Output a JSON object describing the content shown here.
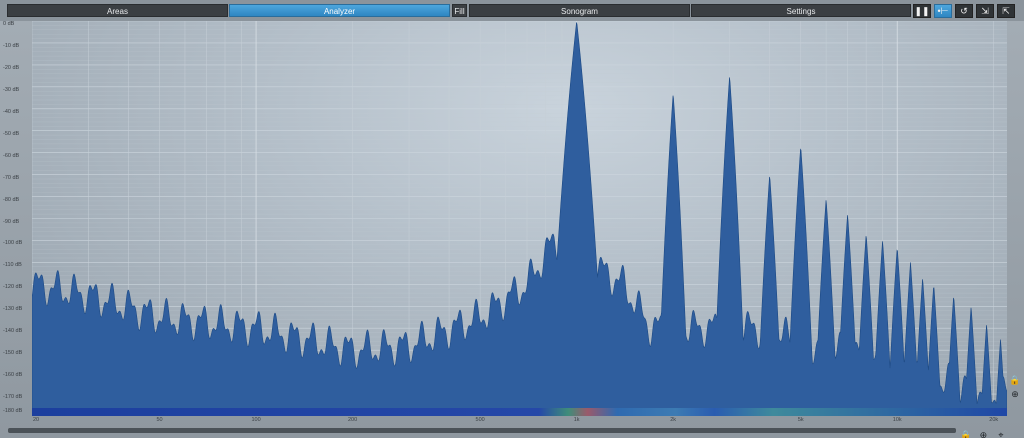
{
  "toolbar": {
    "tabs": [
      {
        "label": "Areas",
        "active": false
      },
      {
        "label": "Analyzer",
        "active": true
      },
      {
        "label": "Fill",
        "active": false
      },
      {
        "label": "Sonogram",
        "active": false
      },
      {
        "label": "Settings",
        "active": false
      }
    ],
    "buttons": [
      {
        "icon": "pause-icon",
        "active": false
      },
      {
        "icon": "freeze-icon",
        "active": true
      },
      {
        "icon": "reset-icon",
        "active": false
      },
      {
        "icon": "load-preset-icon",
        "active": false
      },
      {
        "icon": "save-preset-icon",
        "active": false
      }
    ]
  },
  "analyzer": {
    "db_labels": [
      "0 dB",
      "-10 dB",
      "-20 dB",
      "-30 dB",
      "-40 dB",
      "-50 dB",
      "-60 dB",
      "-70 dB",
      "-80 dB",
      "-90 dB",
      "-100 dB",
      "-110 dB",
      "-120 dB",
      "-130 dB",
      "-140 dB",
      "-150 dB",
      "-160 dB",
      "-170 dB",
      "-180 dB"
    ],
    "freq_labels": [
      "20",
      "50",
      "100",
      "200",
      "500",
      "1k",
      "2k",
      "5k",
      "10k",
      "20k"
    ],
    "colors": {
      "spectrum_fill": "#2f5e9e",
      "spectrum_stroke": "#1d4a85",
      "grid": "#ccd5dd"
    }
  },
  "chart_data": {
    "type": "area",
    "x_scale": "log",
    "xlim": [
      20,
      22000
    ],
    "ylim": [
      -180,
      0
    ],
    "x_unit": "Hz",
    "y_unit": "dB",
    "grid": true,
    "peaks": [
      {
        "freq": 1000,
        "db": 0
      },
      {
        "freq": 2000,
        "db": -33
      },
      {
        "freq": 3000,
        "db": -25
      },
      {
        "freq": 4000,
        "db": -70
      },
      {
        "freq": 5000,
        "db": -57
      },
      {
        "freq": 6000,
        "db": -81
      },
      {
        "freq": 7000,
        "db": -88
      },
      {
        "freq": 8000,
        "db": -97
      },
      {
        "freq": 9000,
        "db": -100
      },
      {
        "freq": 10000,
        "db": -103
      },
      {
        "freq": 11000,
        "db": -110
      },
      {
        "freq": 12000,
        "db": -117
      },
      {
        "freq": 13000,
        "db": -120
      },
      {
        "freq": 15000,
        "db": -125
      },
      {
        "freq": 17000,
        "db": -130
      },
      {
        "freq": 19000,
        "db": -138
      },
      {
        "freq": 21000,
        "db": -145
      }
    ],
    "floor": [
      {
        "freq": 20,
        "db": -120
      },
      {
        "freq": 30,
        "db": -125
      },
      {
        "freq": 50,
        "db": -135
      },
      {
        "freq": 100,
        "db": -140
      },
      {
        "freq": 200,
        "db": -150
      },
      {
        "freq": 300,
        "db": -148
      },
      {
        "freq": 500,
        "db": -135
      },
      {
        "freq": 700,
        "db": -120
      },
      {
        "freq": 850,
        "db": -100
      },
      {
        "freq": 1400,
        "db": -120
      },
      {
        "freq": 1700,
        "db": -140
      },
      {
        "freq": 3600,
        "db": -140
      },
      {
        "freq": 20000,
        "db": -170
      }
    ]
  }
}
